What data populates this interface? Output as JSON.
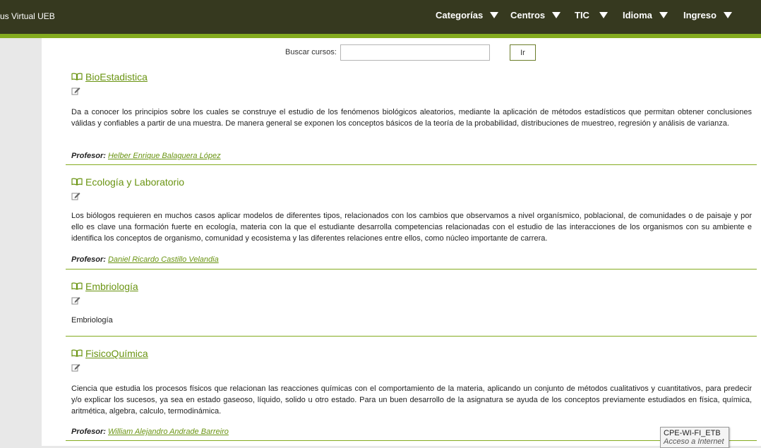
{
  "header": {
    "site_title": "us Virtual UEB",
    "nav": [
      {
        "label": "Categorías"
      },
      {
        "label": "Centros"
      },
      {
        "label": "TIC"
      },
      {
        "label": "Idioma"
      },
      {
        "label": "Ingreso"
      }
    ]
  },
  "search": {
    "label": "Buscar cursos:",
    "value": "",
    "button": "Ir"
  },
  "courses": [
    {
      "title": "BioEstadistica",
      "description": "Da a conocer los principios sobre los cuales se construye el estudio de los fenómenos biológicos aleatorios, mediante la aplicación de métodos estadísticos que permitan obtener conclusiones válidas y confiables a partir de una muestra. De manera general se exponen los conceptos básicos de la teoría de la probabilidad, distribuciones de muestreo, regresión y análisis de varianza.",
      "teacher_label": "Profesor:",
      "teacher": "Helber Enrique Balaguera López"
    },
    {
      "title": "Ecología y Laboratorio",
      "description": "Los biólogos requieren en muchos casos aplicar modelos de diferentes tipos, relacionados con los cambios que observamos a nivel organísmico, poblacional, de comunidades o de paisaje y por ello es clave una formación fuerte en ecología, materia con la que el estudiante desarrolla competencias relacionadas con el estudio de las interacciones de los organismos con su ambiente e identifica los conceptos de organismo, comunidad y ecosistema y las diferentes relaciones entre ellos, como núcleo importante de carrera.",
      "teacher_label": "Profesor:",
      "teacher": "Daniel Ricardo Castillo Velandia"
    },
    {
      "title": "Embriología",
      "description": "Embriología"
    },
    {
      "title": "FisicoQuímica",
      "description": "Ciencia que estudia los procesos físicos que relacionan las reacciones químicas con el comportamiento de la materia, aplicando un conjunto de métodos cualitativos y cuantitativos, para predecir y/o explicar los sucesos, ya sea en estado gaseoso, líquido, solido u otro estado. Para un buen desarrollo de la asignatura se ayuda de los conceptos previamente estudiados en física, química, aritmética, algebra, calculo, termodinámica.",
      "teacher_label": "Profesor:",
      "teacher": "William Alejandro Andrade Barreiro"
    }
  ],
  "tooltip": {
    "line1": "CPE-WI-FI_ETB",
    "line2": "Acceso a Internet"
  },
  "colors": {
    "header_bg": "#36391f",
    "accent_green": "#84ab1f",
    "link_green": "#6a9412"
  }
}
